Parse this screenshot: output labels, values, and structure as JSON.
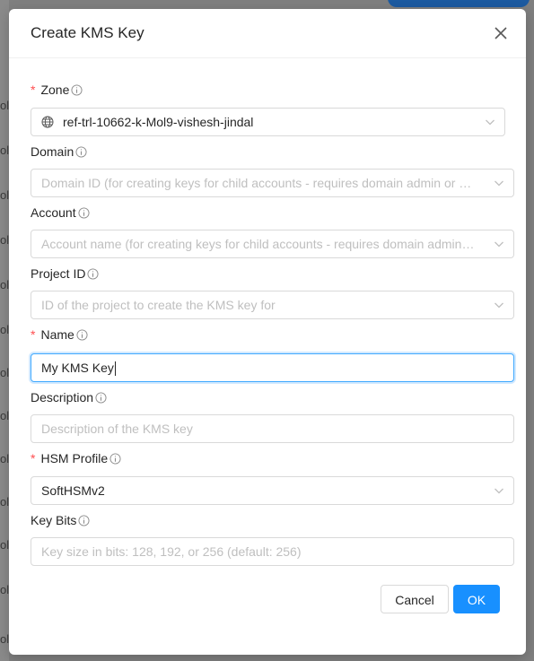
{
  "background": {
    "row_fragment": "ole"
  },
  "modal": {
    "title": "Create KMS Key",
    "fields": {
      "zone": {
        "label": "Zone",
        "required": true,
        "value": "ref-trl-10662-k-Mol9-vishesh-jindal"
      },
      "domain": {
        "label": "Domain",
        "required": false,
        "placeholder": "Domain ID (for creating keys for child accounts - requires domain admin or …"
      },
      "account": {
        "label": "Account",
        "required": false,
        "placeholder": "Account name (for creating keys for child accounts - requires domain admin…"
      },
      "project": {
        "label": "Project ID",
        "required": false,
        "placeholder": "ID of the project to create the KMS key for"
      },
      "name": {
        "label": "Name",
        "required": true,
        "value": "My KMS Key"
      },
      "description": {
        "label": "Description",
        "required": false,
        "placeholder": "Description of the KMS key"
      },
      "hsm_profile": {
        "label": "HSM Profile",
        "required": true,
        "value": "SoftHSMv2"
      },
      "key_bits": {
        "label": "Key Bits",
        "required": false,
        "placeholder": "Key size in bits: 128, 192, or 256 (default: 256)"
      }
    },
    "buttons": {
      "cancel": "Cancel",
      "ok": "OK"
    }
  },
  "colors": {
    "primary": "#1890ff",
    "required": "#ff4d4f",
    "focus_border": "#40a9ff"
  }
}
